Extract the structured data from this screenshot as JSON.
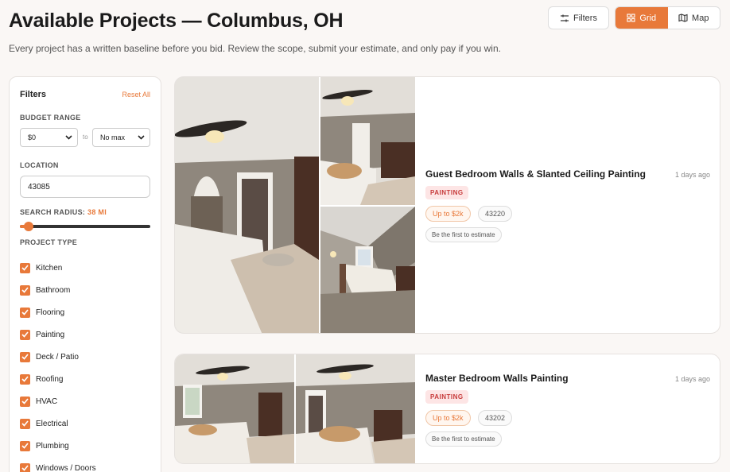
{
  "header": {
    "title": "Available Projects — Columbus, OH",
    "subtitle": "Every project has a written baseline before you bid. Review the scope, submit your estimate, and only pay if you win.",
    "filters_button": "Filters",
    "grid_label": "Grid",
    "map_label": "Map",
    "active_view": "Grid"
  },
  "sidebar": {
    "title": "Filters",
    "reset_label": "Reset All",
    "budget_label": "BUDGET RANGE",
    "budget_min": "$0",
    "budget_to": "to",
    "budget_max": "No max",
    "location_label": "LOCATION",
    "location_value": "43085",
    "radius_label": "SEARCH RADIUS:",
    "radius_value": "38 MI",
    "radius_fraction": 0.07,
    "type_label": "PROJECT TYPE",
    "types": [
      "Kitchen",
      "Bathroom",
      "Flooring",
      "Painting",
      "Deck / Patio",
      "Roofing",
      "HVAC",
      "Electrical",
      "Plumbing",
      "Windows / Doors"
    ]
  },
  "projects": [
    {
      "title": "Guest Bedroom Walls & Slanted Ceiling Painting",
      "time": "1 days ago",
      "category": "PAINTING",
      "budget": "Up to $2k",
      "zip": "43220",
      "cta": "Be the first to estimate"
    },
    {
      "title": "Master Bedroom Walls Painting",
      "time": "1 days ago",
      "category": "PAINTING",
      "budget": "Up to $2k",
      "zip": "43202",
      "cta": "Be the first to estimate"
    }
  ],
  "colors": {
    "accent": "#e8793a",
    "category_bg": "#fde5e5",
    "category_text": "#c73b3b"
  }
}
